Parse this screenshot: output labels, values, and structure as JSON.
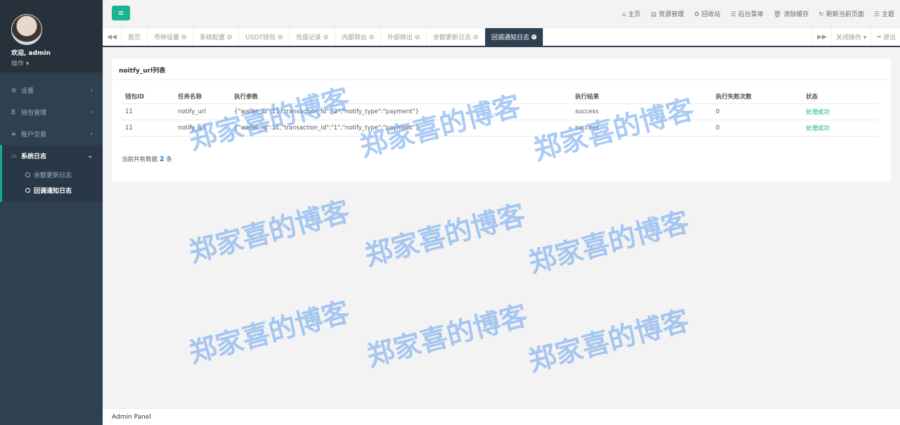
{
  "profile": {
    "welcome": "欢迎, admin",
    "ops": "操作 ▾"
  },
  "menu": [
    {
      "icon": "gears-icon",
      "glyph": "⚙",
      "label": "设置"
    },
    {
      "icon": "bitcoin-icon",
      "glyph": "₿",
      "label": "钱包管理"
    },
    {
      "icon": "list-icon",
      "glyph": "≡",
      "label": "账户交易"
    }
  ],
  "menu_active": {
    "glyph": "▭",
    "label": "系统日志",
    "subs": [
      "余额更新日志",
      "回调通知日志"
    ]
  },
  "topbar": {
    "toggle": "≡",
    "links": [
      {
        "glyph": "⌂",
        "label": "主页"
      },
      {
        "glyph": "▤",
        "label": "资源管理"
      },
      {
        "glyph": "♻",
        "label": "回收站"
      },
      {
        "glyph": "☰",
        "label": "后台菜单"
      },
      {
        "glyph": "🗑",
        "label": "清除缓存"
      },
      {
        "glyph": "↻",
        "label": "刷新当前页面"
      },
      {
        "glyph": "☰",
        "label": "主题"
      }
    ]
  },
  "tabs": [
    "首页",
    "币种设置",
    "系统配置",
    "USDT钱包",
    "充值记录",
    "内部转出",
    "外部转出",
    "余额更新日志",
    "回调通知日志"
  ],
  "tab_right": {
    "close_ops": "关闭操作 ▾",
    "logout": "退出"
  },
  "panel": {
    "title": "noitfy_url列表",
    "headers": [
      "钱包ID",
      "任务名称",
      "执行参数",
      "执行结果",
      "执行失败次数",
      "状态"
    ],
    "rows": [
      [
        "11",
        "notify_url",
        "{\"wallet_id\":11,\"transaction_id\":\"2\",\"notify_type\":\"payment\"}",
        "success",
        "0",
        "处理成功"
      ],
      [
        "11",
        "notify_url",
        "{\"wallet_id\":11,\"transaction_id\":\"1\",\"notify_type\":\"payment\"}",
        "success",
        "0",
        "处理成功"
      ]
    ],
    "total_prefix": "当前共有数据",
    "total_count": "2",
    "total_suffix": "条"
  },
  "footer": "Admin Panel",
  "watermark": "郑家喜的博客"
}
